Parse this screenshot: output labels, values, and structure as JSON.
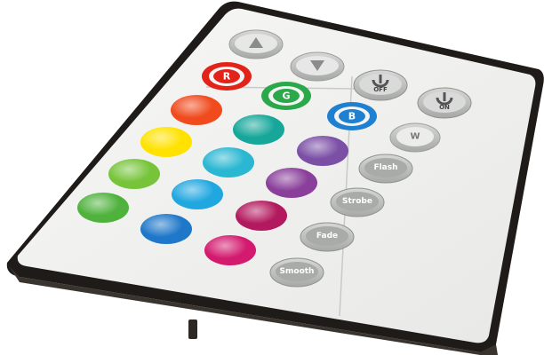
{
  "image": {
    "subject": "IR remote control for RGB LED lighting"
  },
  "colors": {
    "body": "#1f1b18",
    "face": "#f3f3f1",
    "grey_button": "#b9bbb9",
    "red": "#e2231a",
    "green": "#2aa84a",
    "blue": "#1f7fd0"
  },
  "buttons": {
    "brightness_up": {
      "icon": "triangle-up-icon"
    },
    "brightness_down": {
      "icon": "triangle-down-icon"
    },
    "off": {
      "label": "OFF",
      "icon": "power-icon"
    },
    "on": {
      "label": "ON",
      "icon": "power-icon"
    },
    "red": {
      "label": "R"
    },
    "green": {
      "label": "G"
    },
    "blue": {
      "label": "B"
    },
    "white": {
      "label": "W"
    },
    "flash": {
      "label": "Flash"
    },
    "strobe": {
      "label": "Strobe"
    },
    "fade": {
      "label": "Fade"
    },
    "smooth": {
      "label": "Smooth"
    }
  },
  "color_swatches": [
    {
      "name": "orange-red",
      "color": "#f04a1d"
    },
    {
      "name": "teal",
      "color": "#16a79a"
    },
    {
      "name": "purple",
      "color": "#7b4fa6"
    },
    {
      "name": "yellow",
      "color": "#ffe200"
    },
    {
      "name": "cyan",
      "color": "#2ab7d2"
    },
    {
      "name": "violet",
      "color": "#8a3f9a"
    },
    {
      "name": "lime",
      "color": "#77c43b"
    },
    {
      "name": "sky-blue",
      "color": "#20a7e0"
    },
    {
      "name": "magenta",
      "color": "#b3195e"
    },
    {
      "name": "green",
      "color": "#4fb23d"
    },
    {
      "name": "royal-blue",
      "color": "#1e77c9"
    },
    {
      "name": "hot-pink",
      "color": "#d31a6f"
    }
  ]
}
